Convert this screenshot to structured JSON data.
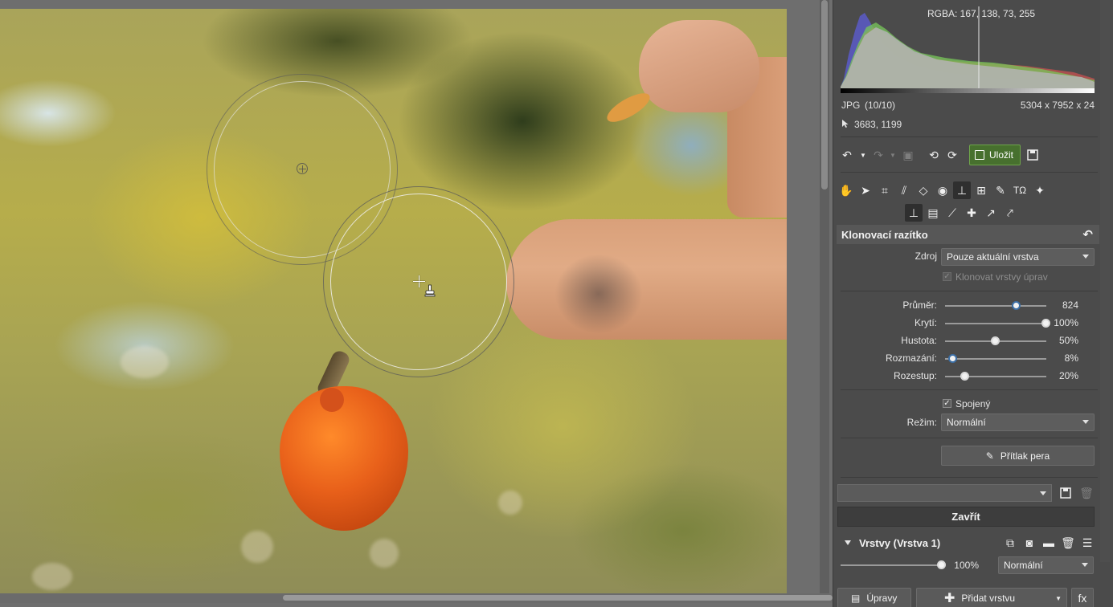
{
  "histogram": {
    "rgba_label": "RGBA: 167, 138,  73, 255"
  },
  "file_info": {
    "format": "JPG",
    "index": "(10/10)",
    "dimensions": "5304 x 7952 x 24",
    "cursor_coords": "3683, 1199"
  },
  "toolbar": {
    "save_label": "Uložit"
  },
  "tools": {
    "row1": [
      "hand-icon",
      "select-arrow-icon",
      "crop-icon",
      "perspective-icon",
      "transform-icon",
      "red-eye-icon",
      "clone-stamp-icon",
      "grid-icon",
      "brush-icon",
      "text-icon",
      "effects-icon"
    ],
    "row2": [
      "clone-stamp-icon",
      "gradient-icon",
      "brush-stroke-icon",
      "healing-icon",
      "smudge-icon",
      "retouch-icon"
    ]
  },
  "clone_stamp": {
    "title": "Klonovací razítko",
    "source_label": "Zdroj",
    "source_value": "Pouze aktuální vrstva",
    "clone_adjust_label": "Klonovat vrstvy úprav",
    "sliders": [
      {
        "label": "Průměr:",
        "value": "824",
        "fraction": 0.71
      },
      {
        "label": "Krytí:",
        "value": "100%",
        "fraction": 1.0
      },
      {
        "label": "Hustota:",
        "value": "50%",
        "fraction": 0.5
      },
      {
        "label": "Rozmazání:",
        "value": "8%",
        "fraction": 0.08
      },
      {
        "label": "Rozestup:",
        "value": "20%",
        "fraction": 0.2
      }
    ],
    "connected_label": "Spojený",
    "mode_label": "Režim:",
    "mode_value": "Normální",
    "pen_pressure_label": "Přítlak pera",
    "close_label": "Zavřít"
  },
  "layers": {
    "title": "Vrstvy (Vrstva 1)",
    "opacity_value": "100%",
    "opacity_fraction": 1.0,
    "blend_mode": "Normální"
  },
  "bottom": {
    "edits_label": "Úpravy",
    "add_layer_label": "Přidat vrstvu",
    "fx_label": "fx"
  },
  "colors": {
    "accent_blue": "#3c6fa6",
    "save_green": "#47702e"
  }
}
